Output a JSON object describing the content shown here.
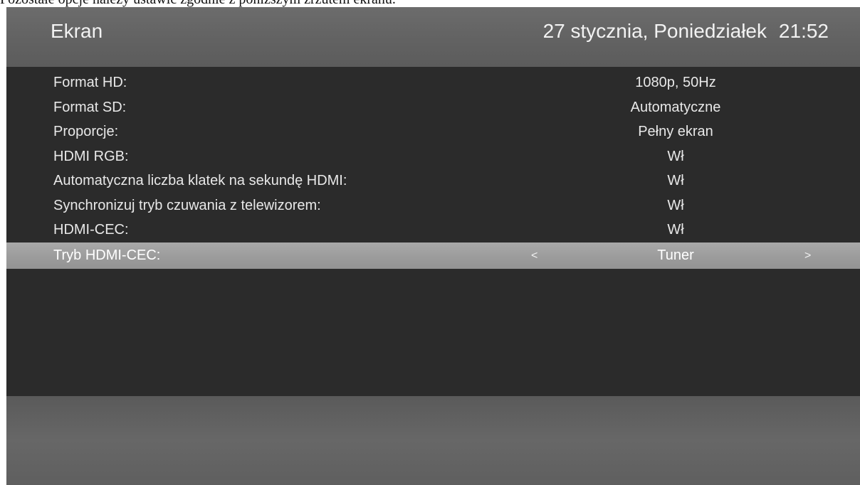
{
  "document": {
    "caption": "Pozostałe opcje należy ustawić zgodnie z poniższym zrzutem ekranu."
  },
  "header": {
    "title": "Ekran",
    "date": "27 stycznia, Poniedziałek",
    "time": "21:52"
  },
  "settings": [
    {
      "label": "Format HD:",
      "value": "1080p, 50Hz"
    },
    {
      "label": "Format SD:",
      "value": "Automatyczne"
    },
    {
      "label": "Proporcje:",
      "value": "Pełny ekran"
    },
    {
      "label": "HDMI RGB:",
      "value": "Wł"
    },
    {
      "label": "Automatyczna liczba klatek na sekundę HDMI:",
      "value": "Wł"
    },
    {
      "label": "Synchronizuj tryb czuwania z telewizorem:",
      "value": "Wł"
    },
    {
      "label": "HDMI-CEC:",
      "value": "Wł"
    },
    {
      "label": "Tryb HDMI-CEC:",
      "value": "Tuner"
    }
  ],
  "selector": {
    "left_arrow": "<",
    "right_arrow": ">"
  },
  "icons": {
    "left_arrow": "chevron-left-icon",
    "right_arrow": "chevron-right-icon"
  },
  "colors": {
    "background": "#2b2b2b",
    "header": "#656565",
    "selected_row": "#a0a0a0",
    "text": "#e8e8e8"
  }
}
